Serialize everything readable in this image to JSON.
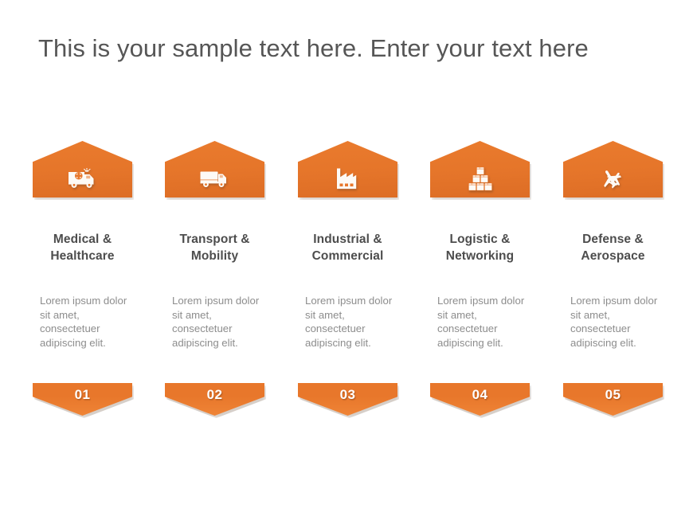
{
  "slide": {
    "title": "This is your sample text here. Enter your text here",
    "background_color": "#FFFFFF",
    "accent_color": "#E8772B",
    "heading_color": "#4D4D4D",
    "body_color": "#8D8D8D"
  },
  "columns": [
    {
      "icon": "ambulance-icon",
      "heading_line1": "Medical &",
      "heading_line2": "Healthcare",
      "body": "Lorem ipsum dolor sit amet, consectetuer adipiscing elit.",
      "number": "01"
    },
    {
      "icon": "delivery-truck-icon",
      "heading_line1": "Transport &",
      "heading_line2": "Mobility",
      "body": "Lorem ipsum dolor sit amet, consectetuer adipiscing elit.",
      "number": "02"
    },
    {
      "icon": "factory-icon",
      "heading_line1": "Industrial &",
      "heading_line2": "Commercial",
      "body": "Lorem ipsum dolor sit amet, consectetuer adipiscing elit.",
      "number": "03"
    },
    {
      "icon": "stacked-boxes-icon",
      "heading_line1": "Logistic &",
      "heading_line2": "Networking",
      "body": "Lorem ipsum dolor sit amet, consectetuer adipiscing elit.",
      "number": "04"
    },
    {
      "icon": "airplane-icon",
      "heading_line1": "Defense &",
      "heading_line2": "Aerospace",
      "body": "Lorem ipsum dolor sit amet, consectetuer adipiscing elit.",
      "number": "05"
    }
  ]
}
